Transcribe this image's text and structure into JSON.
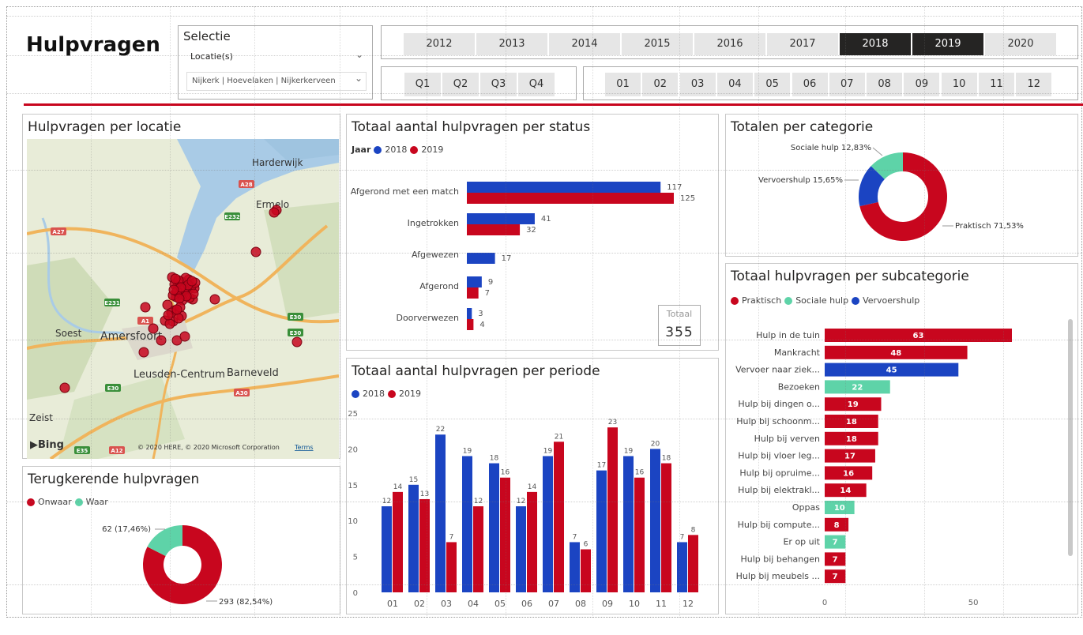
{
  "header": {
    "title": "Hulpvragen"
  },
  "selectie": {
    "label": "Selectie",
    "dropdown1": "Locatie(s)",
    "dropdown2": "Nijkerk | Hoevelaken | Nijkerkerveen"
  },
  "years": [
    {
      "label": "2012",
      "selected": false
    },
    {
      "label": "2013",
      "selected": false
    },
    {
      "label": "2014",
      "selected": false
    },
    {
      "label": "2015",
      "selected": false
    },
    {
      "label": "2016",
      "selected": false
    },
    {
      "label": "2017",
      "selected": false
    },
    {
      "label": "2018",
      "selected": true
    },
    {
      "label": "2019",
      "selected": true
    },
    {
      "label": "2020",
      "selected": false
    }
  ],
  "quarters": [
    "Q1",
    "Q2",
    "Q3",
    "Q4"
  ],
  "months": [
    "01",
    "02",
    "03",
    "04",
    "05",
    "06",
    "07",
    "08",
    "09",
    "10",
    "11",
    "12"
  ],
  "colors": {
    "y2018": "#1B44C2",
    "y2019": "#C8061E",
    "teal": "#5ED3A8",
    "accent": "#C8061E"
  },
  "map": {
    "title": "Hulpvragen per locatie",
    "labels": [
      "Harderwijk",
      "Ermelo",
      "Soest",
      "Amersfoort",
      "Leusden-Centrum",
      "Barneveld",
      "Zeist"
    ],
    "roads": [
      "A28",
      "E232",
      "A27",
      "E231",
      "A1",
      "E30",
      "A30",
      "E35",
      "A12"
    ],
    "bing": "Bing",
    "copyright": "© 2020 HERE, © 2020 Microsoft Corporation",
    "terms": "Terms"
  },
  "terug": {
    "title": "Terugkerende hulpvragen",
    "legend": [
      "Onwaar",
      "Waar"
    ],
    "labels": [
      "62 (17,46%)",
      "293 (82,54%)"
    ]
  },
  "status": {
    "title": "Totaal aantal hulpvragen per status",
    "legend_title": "Jaar",
    "legend": [
      "2018",
      "2019"
    ],
    "total_label": "Totaal",
    "total_value": "355"
  },
  "periode": {
    "title": "Totaal aantal hulpvragen per periode",
    "legend": [
      "2018",
      "2019"
    ]
  },
  "categorie": {
    "title": "Totalen per categorie",
    "labels": [
      "Sociale hulp 12,83%",
      "Vervoershulp 15,65%",
      "Praktisch 71,53%"
    ]
  },
  "subcat": {
    "title": "Totaal hulpvragen per subcategorie",
    "legend": [
      "Praktisch",
      "Sociale hulp",
      "Vervoershulp"
    ]
  },
  "chart_data": [
    {
      "type": "bar",
      "title": "Totaal aantal hulpvragen per status",
      "categories": [
        "Afgerond met een match",
        "Ingetrokken",
        "Afgewezen",
        "Afgerond",
        "Doorverwezen"
      ],
      "series": [
        {
          "name": "2018",
          "values": [
            117,
            41,
            17,
            9,
            3
          ]
        },
        {
          "name": "2019",
          "values": [
            125,
            32,
            null,
            7,
            4
          ]
        }
      ]
    },
    {
      "type": "bar",
      "title": "Totaal aantal hulpvragen per periode",
      "categories": [
        "01",
        "02",
        "03",
        "04",
        "05",
        "06",
        "07",
        "08",
        "09",
        "10",
        "11",
        "12"
      ],
      "series": [
        {
          "name": "2018",
          "values": [
            12,
            15,
            22,
            19,
            18,
            12,
            19,
            7,
            17,
            19,
            20,
            7
          ]
        },
        {
          "name": "2019",
          "values": [
            14,
            13,
            7,
            12,
            16,
            14,
            21,
            6,
            23,
            16,
            18,
            8
          ]
        }
      ],
      "ylim": [
        0,
        25
      ],
      "yticks": [
        0,
        5,
        10,
        15,
        20,
        25
      ]
    },
    {
      "type": "pie",
      "title": "Totalen per categorie",
      "categories": [
        "Praktisch",
        "Vervoershulp",
        "Sociale hulp"
      ],
      "values": [
        71.53,
        15.65,
        12.83
      ]
    },
    {
      "type": "pie",
      "title": "Terugkerende hulpvragen",
      "categories": [
        "Onwaar",
        "Waar"
      ],
      "values": [
        293,
        62
      ]
    },
    {
      "type": "bar",
      "title": "Totaal hulpvragen per subcategorie",
      "categories": [
        "Hulp in de tuin",
        "Mankracht",
        "Vervoer naar ziek...",
        "Bezoeken",
        "Hulp bij dingen o...",
        "Hulp bij schoonm...",
        "Hulp bij verven",
        "Hulp bij vloer leg...",
        "Hulp bij opruime...",
        "Hulp bij elektrakl...",
        "Oppas",
        "Hulp bij compute...",
        "Er op uit",
        "Hulp bij behangen",
        "Hulp bij meubels ..."
      ],
      "values": [
        63,
        48,
        45,
        22,
        19,
        18,
        18,
        17,
        16,
        14,
        10,
        8,
        7,
        7,
        7
      ],
      "groups": [
        "Praktisch",
        "Praktisch",
        "Vervoershulp",
        "Sociale hulp",
        "Praktisch",
        "Praktisch",
        "Praktisch",
        "Praktisch",
        "Praktisch",
        "Praktisch",
        "Sociale hulp",
        "Praktisch",
        "Sociale hulp",
        "Praktisch",
        "Praktisch"
      ],
      "xticks": [
        0,
        50
      ]
    }
  ]
}
